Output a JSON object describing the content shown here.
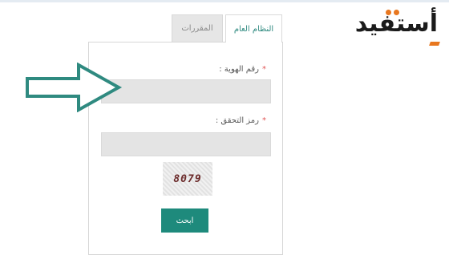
{
  "logo": {
    "text": "أستفيد"
  },
  "tabs": [
    {
      "label": "النظام العام",
      "active": true
    },
    {
      "label": "المقررات",
      "active": false
    }
  ],
  "form": {
    "id_label": "رقم الهوية :",
    "id_value": "",
    "verify_label": "رمز التحقق :",
    "verify_value": "",
    "captcha": "8079",
    "submit_label": "ابحث"
  },
  "colors": {
    "accent": "#1e8a7c",
    "arrow": "#2f8a80",
    "logo_accent": "#e8771f"
  },
  "icons": {
    "arrow": "arrow-right-icon"
  }
}
